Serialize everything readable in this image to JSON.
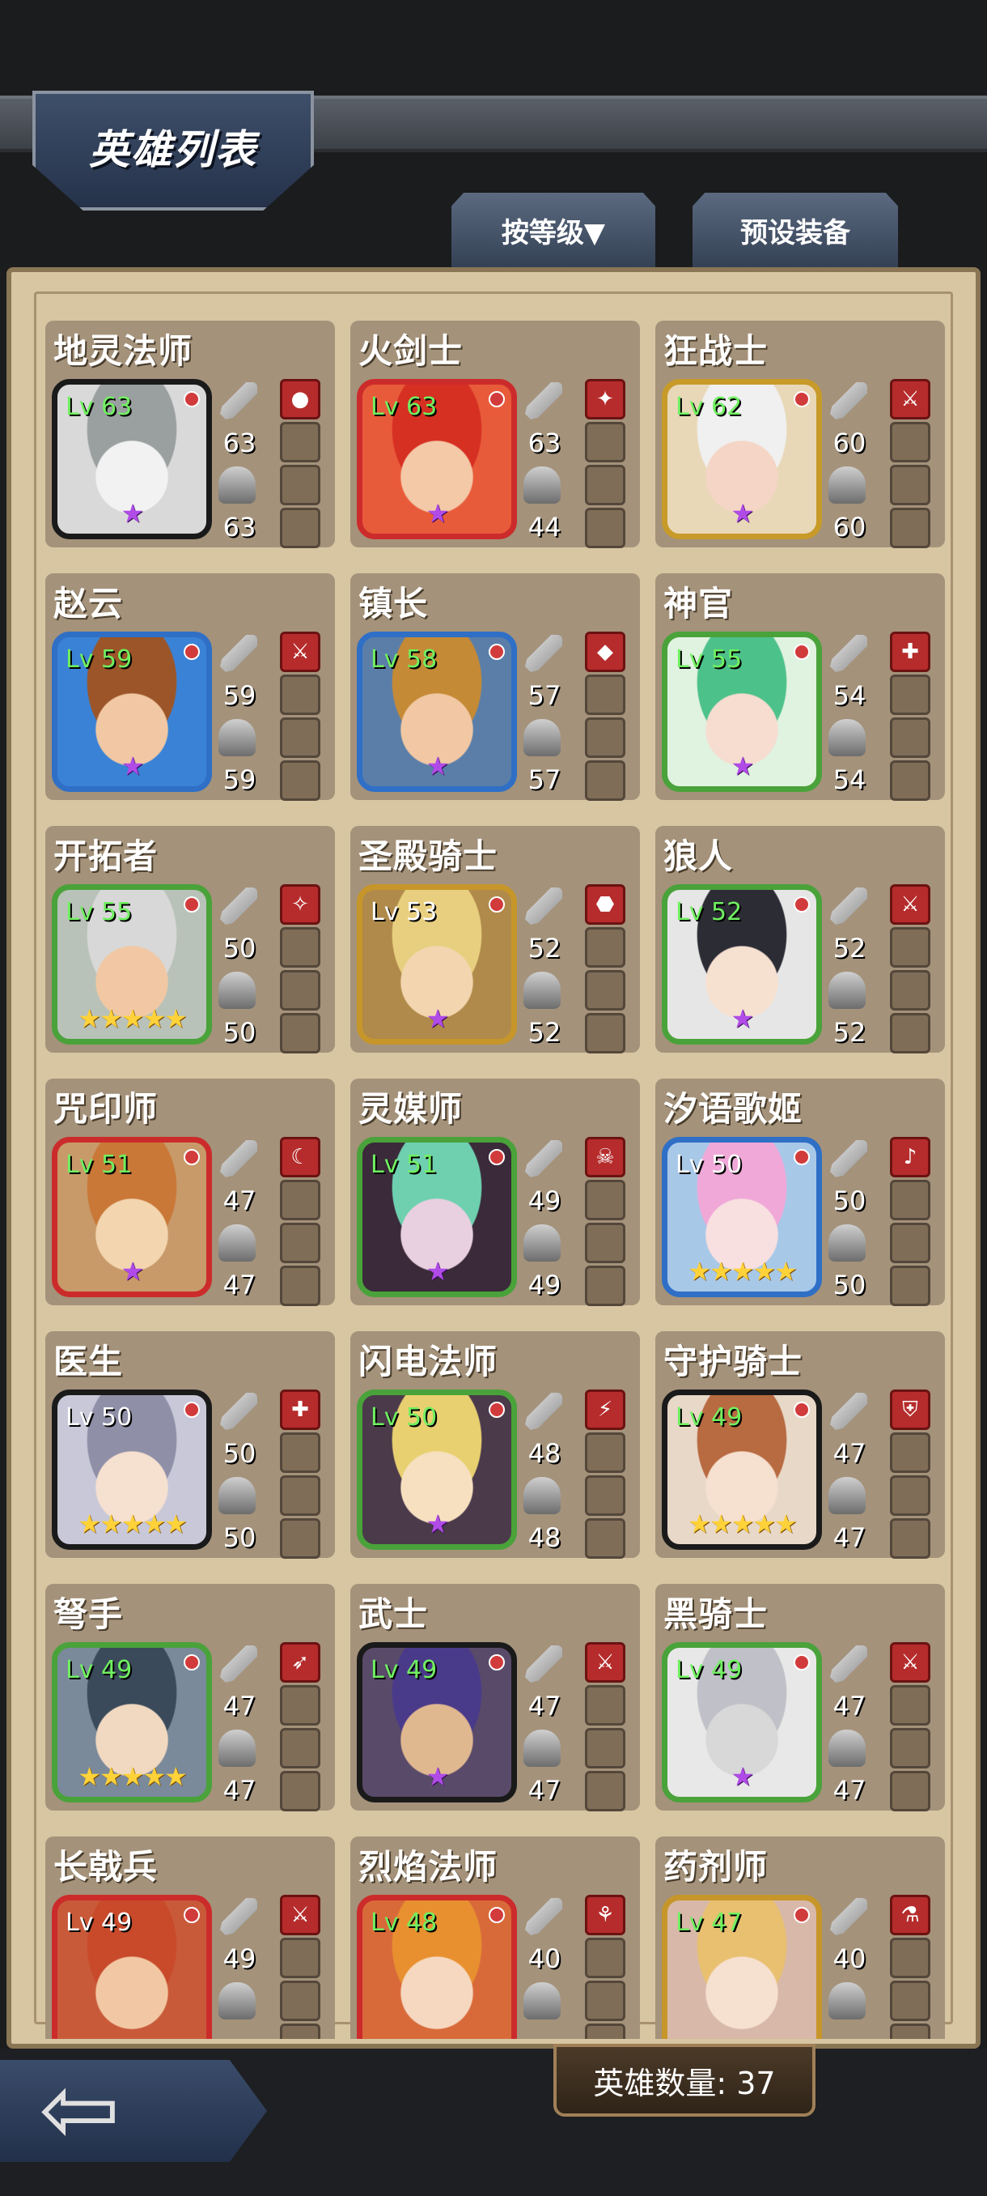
{
  "header": {
    "title": "英雄列表",
    "sort_tab": "按等级▼",
    "preset_tab": "预设装备"
  },
  "heroes": [
    {
      "name": "地灵法师",
      "level": "Lv 63",
      "attack": "63",
      "defense": "63",
      "stars": "★",
      "star_color": "purple",
      "frame": "#1a1a1a",
      "bg": "#d9d9d9",
      "face": "#f2f2f2",
      "hair": "#9aa0a0",
      "slot_icon": "●"
    },
    {
      "name": "火剑士",
      "level": "Lv 63",
      "attack": "63",
      "defense": "44",
      "stars": "★",
      "star_color": "purple",
      "frame": "#cc2b2b",
      "bg": "#e85b3a",
      "face": "#f3c9a8",
      "hair": "#d63022",
      "slot_icon": "✦"
    },
    {
      "name": "狂战士",
      "level": "Lv 62",
      "attack": "60",
      "defense": "60",
      "stars": "★",
      "star_color": "purple",
      "frame": "#c79a2a",
      "bg": "#e8d8b8",
      "face": "#f5d5c5",
      "hair": "#f0f0f0",
      "slot_icon": "⚔"
    },
    {
      "name": "赵云",
      "level": "Lv 59",
      "attack": "59",
      "defense": "59",
      "stars": "★",
      "star_color": "purple",
      "frame": "#2f6fc6",
      "bg": "#3a82d6",
      "face": "#f1c8a3",
      "hair": "#9b5528",
      "slot_icon": "⚔"
    },
    {
      "name": "镇长",
      "level": "Lv 58",
      "attack": "57",
      "defense": "57",
      "stars": "★",
      "star_color": "purple",
      "frame": "#2f6fc6",
      "bg": "#5a7ea8",
      "face": "#f1c8a3",
      "hair": "#c58a35",
      "slot_icon": "◆"
    },
    {
      "name": "神官",
      "level": "Lv 55",
      "attack": "54",
      "defense": "54",
      "stars": "★",
      "star_color": "purple",
      "frame": "#4aa23a",
      "bg": "#e0f2e0",
      "face": "#f6ddd0",
      "hair": "#4dc18a",
      "slot_icon": "✚"
    },
    {
      "name": "开拓者",
      "level": "Lv 55",
      "attack": "50",
      "defense": "50",
      "stars": "★★★★★",
      "star_color": "gold",
      "frame": "#4aa23a",
      "bg": "#b8c2b8",
      "face": "#f1c8a3",
      "hair": "#d8d8d8",
      "slot_icon": "✧"
    },
    {
      "name": "圣殿骑士",
      "level": "Lv 53",
      "attack": "52",
      "defense": "52",
      "stars": "★",
      "star_color": "purple",
      "frame": "#c7962a",
      "bg": "#b08a4a",
      "face": "#f3d6b0",
      "hair": "#e8cf80",
      "slot_icon": "⬣",
      "level_white": true
    },
    {
      "name": "狼人",
      "level": "Lv 52",
      "attack": "52",
      "defense": "52",
      "stars": "★",
      "star_color": "purple",
      "frame": "#4aa23a",
      "bg": "#e6e6e6",
      "face": "#f6e0d0",
      "hair": "#2c2c35",
      "slot_icon": "⚔"
    },
    {
      "name": "咒印师",
      "level": "Lv 51",
      "attack": "47",
      "defense": "47",
      "stars": "★",
      "star_color": "purple",
      "frame": "#cc2b2b",
      "bg": "#c89a6a",
      "face": "#f3d6b0",
      "hair": "#c97838",
      "slot_icon": "☾"
    },
    {
      "name": "灵媒师",
      "level": "Lv 51",
      "attack": "49",
      "defense": "49",
      "stars": "★",
      "star_color": "purple",
      "frame": "#4aa23a",
      "bg": "#3a2a3a",
      "face": "#e8d0e0",
      "hair": "#6fd0b0",
      "slot_icon": "☠"
    },
    {
      "name": "汐语歌姬",
      "level": "Lv 50",
      "attack": "50",
      "defense": "50",
      "stars": "★★★★★",
      "star_color": "gold",
      "frame": "#2f6fc6",
      "bg": "#a8c8e8",
      "face": "#f8e0e0",
      "hair": "#f0a8d8",
      "slot_icon": "♪",
      "level_white": true
    },
    {
      "name": "医生",
      "level": "Lv 50",
      "attack": "50",
      "defense": "50",
      "stars": "★★★★★",
      "star_color": "gold",
      "frame": "#1a1a1a",
      "bg": "#c8c8d8",
      "face": "#f6e0d0",
      "hair": "#8f8fa8",
      "slot_icon": "✚",
      "level_white": true
    },
    {
      "name": "闪电法师",
      "level": "Lv 50",
      "attack": "48",
      "defense": "48",
      "stars": "★",
      "star_color": "purple",
      "frame": "#4aa23a",
      "bg": "#4a3a4a",
      "face": "#f6e0c0",
      "hair": "#e8d070",
      "slot_icon": "⚡"
    },
    {
      "name": "守护骑士",
      "level": "Lv 49",
      "attack": "47",
      "defense": "47",
      "stars": "★★★★★",
      "star_color": "gold",
      "frame": "#1a1a1a",
      "bg": "#e8d8c8",
      "face": "#f6e0d0",
      "hair": "#b86a40",
      "slot_icon": "⛨"
    },
    {
      "name": "弩手",
      "level": "Lv 49",
      "attack": "47",
      "defense": "47",
      "stars": "★★★★★",
      "star_color": "gold",
      "frame": "#4aa23a",
      "bg": "#7a8a9a",
      "face": "#f1d8c0",
      "hair": "#3a4a5a",
      "slot_icon": "➶"
    },
    {
      "name": "武士",
      "level": "Lv 49",
      "attack": "47",
      "defense": "47",
      "stars": "★",
      "star_color": "purple",
      "frame": "#1a1a1a",
      "bg": "#5a4a6a",
      "face": "#e0b890",
      "hair": "#4a3a8a",
      "slot_icon": "⚔"
    },
    {
      "name": "黑骑士",
      "level": "Lv 49",
      "attack": "47",
      "defense": "47",
      "stars": "★",
      "star_color": "purple",
      "frame": "#4aa23a",
      "bg": "#e8e8e8",
      "face": "#d8d8d8",
      "hair": "#c0c0c8",
      "slot_icon": "⚔"
    },
    {
      "name": "长戟兵",
      "level": "Lv 49",
      "attack": "49",
      "defense": "",
      "stars": "",
      "star_color": "purple",
      "frame": "#cc2b2b",
      "bg": "#c85a3a",
      "face": "#f1c8a3",
      "hair": "#c84a2a",
      "slot_icon": "⚔",
      "level_white": true
    },
    {
      "name": "烈焰法师",
      "level": "Lv 48",
      "attack": "40",
      "defense": "",
      "stars": "",
      "star_color": "purple",
      "frame": "#cc2b2b",
      "bg": "#d86a3a",
      "face": "#f6d8c0",
      "hair": "#e89030",
      "slot_icon": "⚘"
    },
    {
      "name": "药剂师",
      "level": "Lv 47",
      "attack": "40",
      "defense": "",
      "stars": "",
      "star_color": "purple",
      "frame": "#c7962a",
      "bg": "#d8b8a8",
      "face": "#f6e0d0",
      "hair": "#e8c070",
      "slot_icon": "⚗"
    }
  ],
  "footer": {
    "hero_count": "英雄数量: 37"
  },
  "colors": {
    "panel_bg": "#d8c5a2",
    "card_bg": "#a4927a",
    "level_green": "#70f060",
    "tab_blue": "#344155"
  }
}
